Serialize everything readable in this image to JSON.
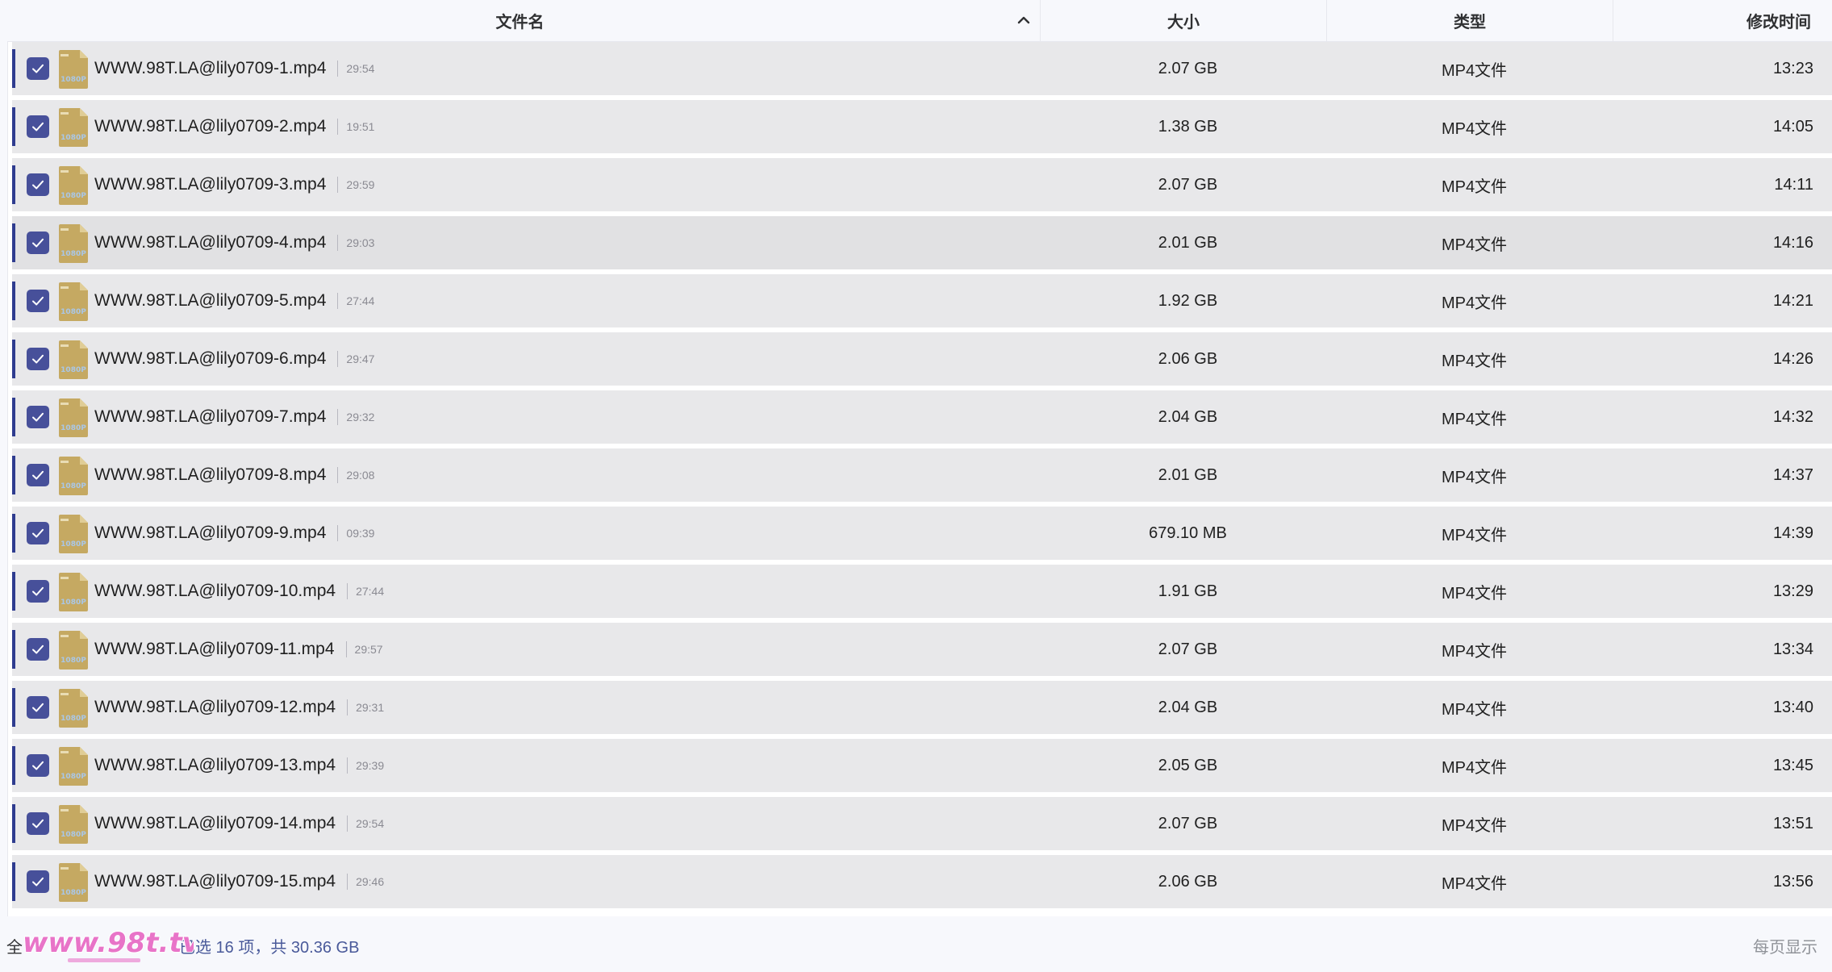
{
  "header": {
    "name": "文件名",
    "size": "大小",
    "type": "类型",
    "time": "修改时间"
  },
  "icons": {
    "sort": "chevron-up-icon",
    "checkbox": "check-icon",
    "file": "video-file-icon",
    "file_badge": "1080P"
  },
  "colors": {
    "accent": "#47509a",
    "selection_bar": "#2f3c8f",
    "summary_text": "#4a5a9a",
    "file_icon": "#c5a962"
  },
  "files": [
    {
      "name": "WWW.98T.LA@lily0709-1.mp4",
      "duration": "29:54",
      "size": "2.07 GB",
      "type": "MP4文件",
      "time": "13:23"
    },
    {
      "name": "WWW.98T.LA@lily0709-2.mp4",
      "duration": "19:51",
      "size": "1.38 GB",
      "type": "MP4文件",
      "time": "14:05"
    },
    {
      "name": "WWW.98T.LA@lily0709-3.mp4",
      "duration": "29:59",
      "size": "2.07 GB",
      "type": "MP4文件",
      "time": "14:11"
    },
    {
      "name": "WWW.98T.LA@lily0709-4.mp4",
      "duration": "29:03",
      "size": "2.01 GB",
      "type": "MP4文件",
      "time": "14:16"
    },
    {
      "name": "WWW.98T.LA@lily0709-5.mp4",
      "duration": "27:44",
      "size": "1.92 GB",
      "type": "MP4文件",
      "time": "14:21"
    },
    {
      "name": "WWW.98T.LA@lily0709-6.mp4",
      "duration": "29:47",
      "size": "2.06 GB",
      "type": "MP4文件",
      "time": "14:26"
    },
    {
      "name": "WWW.98T.LA@lily0709-7.mp4",
      "duration": "29:32",
      "size": "2.04 GB",
      "type": "MP4文件",
      "time": "14:32"
    },
    {
      "name": "WWW.98T.LA@lily0709-8.mp4",
      "duration": "29:08",
      "size": "2.01 GB",
      "type": "MP4文件",
      "time": "14:37"
    },
    {
      "name": "WWW.98T.LA@lily0709-9.mp4",
      "duration": "09:39",
      "size": "679.10 MB",
      "type": "MP4文件",
      "time": "14:39"
    },
    {
      "name": "WWW.98T.LA@lily0709-10.mp4",
      "duration": "27:44",
      "size": "1.91 GB",
      "type": "MP4文件",
      "time": "13:29"
    },
    {
      "name": "WWW.98T.LA@lily0709-11.mp4",
      "duration": "29:57",
      "size": "2.07 GB",
      "type": "MP4文件",
      "time": "13:34"
    },
    {
      "name": "WWW.98T.LA@lily0709-12.mp4",
      "duration": "29:31",
      "size": "2.04 GB",
      "type": "MP4文件",
      "time": "13:40"
    },
    {
      "name": "WWW.98T.LA@lily0709-13.mp4",
      "duration": "29:39",
      "size": "2.05 GB",
      "type": "MP4文件",
      "time": "13:45"
    },
    {
      "name": "WWW.98T.LA@lily0709-14.mp4",
      "duration": "29:54",
      "size": "2.07 GB",
      "type": "MP4文件",
      "time": "13:51"
    },
    {
      "name": "WWW.98T.LA@lily0709-15.mp4",
      "duration": "29:46",
      "size": "2.06 GB",
      "type": "MP4文件",
      "time": "13:56"
    }
  ],
  "footer": {
    "select_all": "全",
    "summary": "已选 16 项，共 30.36 GB",
    "per_page": "每页显示"
  },
  "watermark": {
    "text": "www.98t.tv"
  }
}
